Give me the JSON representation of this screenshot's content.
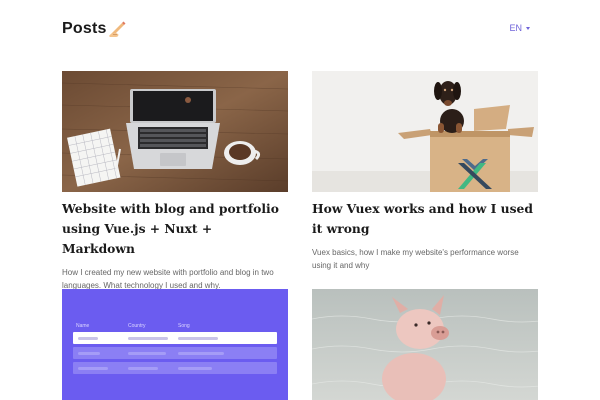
{
  "header": {
    "title": "Posts",
    "title_icon": "writing-hand-icon",
    "language": "EN"
  },
  "posts": [
    {
      "title": "Website with blog and portfolio using Vue.js + Nuxt + Markdown",
      "description": "How I created my new website with portfolio and blog in two languages. What technology I used and why.",
      "image": "laptop-on-wooden-desk-image"
    },
    {
      "title": "How Vuex works and how I used it wrong",
      "description": "Vuex basics, how I make my website's performance worse using it and why",
      "image": "dachshund-in-cardboard-box-image"
    },
    {
      "title": "",
      "description": "",
      "image": "table-ui-illustration-image",
      "table_headers": [
        "Name",
        "Country",
        "Song"
      ]
    },
    {
      "title": "",
      "description": "",
      "image": "piglet-in-water-image"
    }
  ],
  "colors": {
    "accent": "#6f63d9",
    "illustration_bg": "#6b5cf0"
  }
}
